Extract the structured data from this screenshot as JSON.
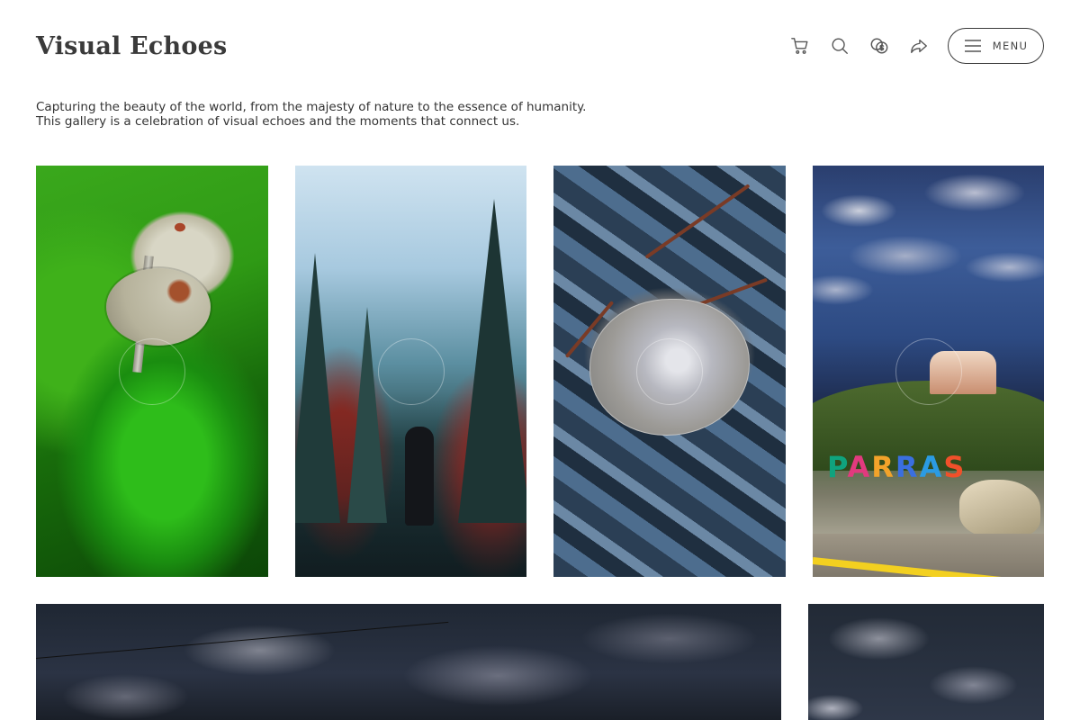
{
  "site": {
    "title": "Visual Echoes",
    "intro": "Capturing the beauty of the world, from the majesty of nature to the essence of humanity. This gallery is a celebration of visual echoes and the moments that connect us."
  },
  "header": {
    "icons": [
      "cart-icon",
      "search-icon",
      "currency-icon",
      "share-icon"
    ],
    "menu_label": "MENU"
  },
  "gallery": {
    "row1": [
      {
        "subject": "mushroom-on-moss"
      },
      {
        "subject": "hiker-forest-path"
      },
      {
        "subject": "leaf-on-blue-rocks"
      },
      {
        "subject": "parras-night-sign",
        "sign_text": "PARRAS"
      }
    ],
    "row2": [
      {
        "subject": "night-clouds-wide"
      },
      {
        "subject": "night-clouds"
      }
    ]
  },
  "colors": {
    "title": "#3a3a3a",
    "text": "#333333",
    "border": "#3a3a3a",
    "background": "#ffffff"
  }
}
